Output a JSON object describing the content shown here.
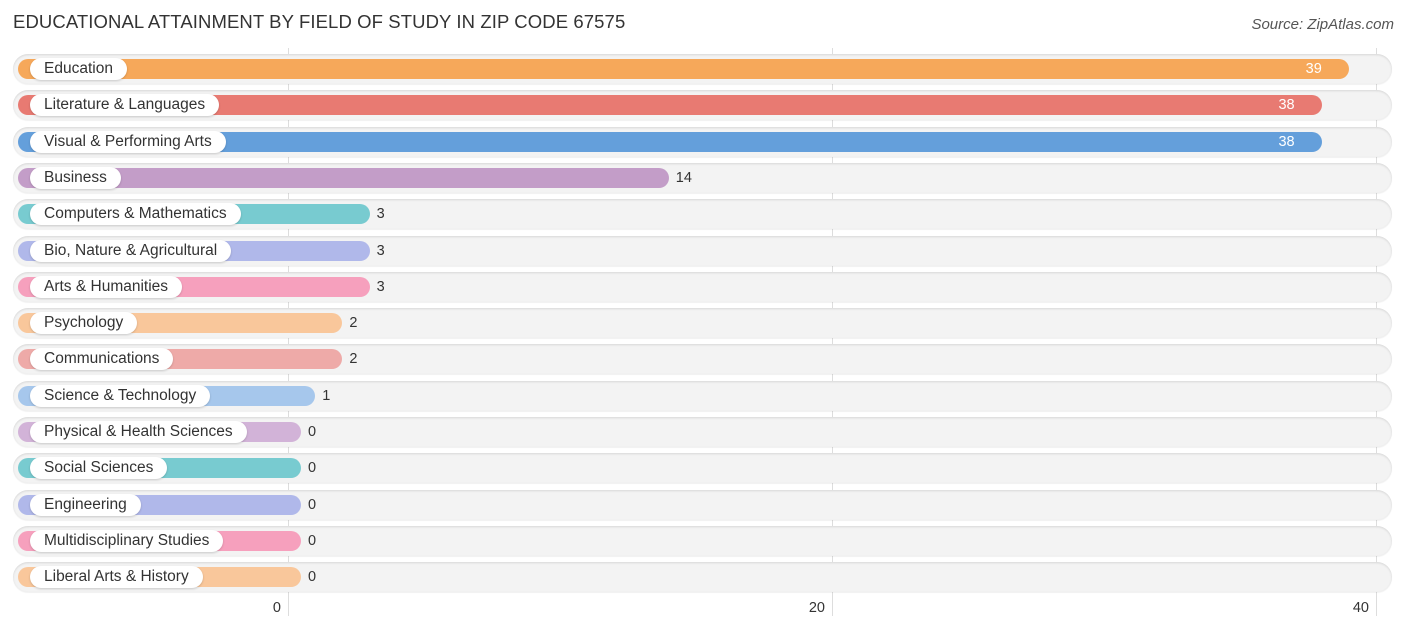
{
  "chart_data": {
    "type": "bar",
    "orientation": "horizontal",
    "title": "EDUCATIONAL ATTAINMENT BY FIELD OF STUDY IN ZIP CODE 67575",
    "source": "Source: ZipAtlas.com",
    "xlabel": "",
    "ylabel": "",
    "xlim": [
      0,
      40
    ],
    "x_ticks": [
      "0",
      "20",
      "40"
    ],
    "grid": true,
    "categories": [
      "Education",
      "Literature & Languages",
      "Visual & Performing Arts",
      "Business",
      "Computers & Mathematics",
      "Bio, Nature & Agricultural",
      "Arts & Humanities",
      "Psychology",
      "Communications",
      "Science & Technology",
      "Physical & Health Sciences",
      "Social Sciences",
      "Engineering",
      "Multidisciplinary Studies",
      "Liberal Arts & History"
    ],
    "values": [
      39,
      38,
      38,
      14,
      3,
      3,
      3,
      2,
      2,
      1,
      0,
      0,
      0,
      0,
      0
    ],
    "colors": [
      "#f6a85a",
      "#e87a72",
      "#649fdb",
      "#c39dc8",
      "#78cbd0",
      "#b0b8ea",
      "#f6a0bd",
      "#f9c79b",
      "#eeaaa8",
      "#a6c7ec",
      "#d2b3d8",
      "#78cbd0",
      "#b0b8ea",
      "#f6a0bd",
      "#f9c79b"
    ]
  }
}
